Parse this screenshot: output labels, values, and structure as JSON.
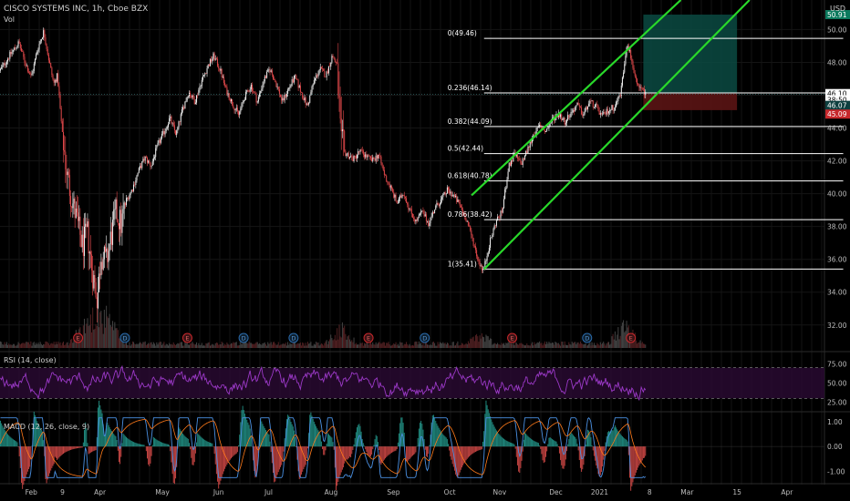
{
  "header": {
    "title": "CISCO SYSTEMS INC, 1h, Cboe BZX",
    "vol_label": "Vol",
    "currency": "USD"
  },
  "colors": {
    "up": "#f0f0f0",
    "down": "#e0484a",
    "channel": "#29d82a",
    "fib": "#ffffff",
    "rsi": "#9b39c7",
    "macd": "#4a90e2",
    "signal": "#ff7a1a",
    "profit_zone": "#0a4a42",
    "loss_zone": "#5a1414",
    "grid": "#1a1a1a"
  },
  "chart_data": [
    {
      "type": "line",
      "name": "price-pane",
      "subtype": "candlestick",
      "y_range": [
        30.6,
        51.8
      ],
      "y_ticks": [
        {
          "v": 50,
          "label": "50.00"
        },
        {
          "v": 48,
          "label": "48.00"
        },
        {
          "v": 46,
          "label": "46.00"
        },
        {
          "v": 44,
          "label": "44.00"
        },
        {
          "v": 42,
          "label": "42.00"
        },
        {
          "v": 40,
          "label": "40.00"
        },
        {
          "v": 38,
          "label": "38.00"
        },
        {
          "v": 36,
          "label": "36.00"
        },
        {
          "v": 34,
          "label": "34.00"
        },
        {
          "v": 32,
          "label": "32.00"
        }
      ],
      "x_ticks": [
        {
          "t": 0.5,
          "label": "Feb"
        },
        {
          "t": 1.0,
          "label": "9"
        },
        {
          "t": 1.6,
          "label": "Apr"
        },
        {
          "t": 2.6,
          "label": "May"
        },
        {
          "t": 3.5,
          "label": "Jun"
        },
        {
          "t": 4.3,
          "label": "Jul"
        },
        {
          "t": 5.3,
          "label": "Aug"
        },
        {
          "t": 6.3,
          "label": "Sep"
        },
        {
          "t": 7.2,
          "label": "Oct"
        },
        {
          "t": 8.0,
          "label": "Nov"
        },
        {
          "t": 8.9,
          "label": "Dec"
        },
        {
          "t": 9.6,
          "label": "2021"
        },
        {
          "t": 10.4,
          "label": "8"
        },
        {
          "t": 11.0,
          "label": "Mar"
        },
        {
          "t": 11.8,
          "label": "15"
        },
        {
          "t": 12.6,
          "label": "Apr"
        }
      ],
      "t_range": [
        0,
        13.2
      ],
      "price_path": [
        [
          0.0,
          47.5
        ],
        [
          0.15,
          48.4
        ],
        [
          0.3,
          49.2
        ],
        [
          0.4,
          48.0
        ],
        [
          0.5,
          47.1
        ],
        [
          0.6,
          48.8
        ],
        [
          0.7,
          49.9
        ],
        [
          0.78,
          48.2
        ],
        [
          0.86,
          46.7
        ],
        [
          0.92,
          47.2
        ],
        [
          1.0,
          43.5
        ],
        [
          1.08,
          41.0
        ],
        [
          1.16,
          39.5
        ],
        [
          1.24,
          38.2
        ],
        [
          1.32,
          36.8
        ],
        [
          1.4,
          37.6
        ],
        [
          1.48,
          35.2
        ],
        [
          1.56,
          33.6
        ],
        [
          1.62,
          36.4
        ],
        [
          1.7,
          35.8
        ],
        [
          1.78,
          37.4
        ],
        [
          1.86,
          38.9
        ],
        [
          1.94,
          38.1
        ],
        [
          2.02,
          39.6
        ],
        [
          2.12,
          40.3
        ],
        [
          2.22,
          41.4
        ],
        [
          2.32,
          42.2
        ],
        [
          2.42,
          41.7
        ],
        [
          2.52,
          42.9
        ],
        [
          2.62,
          43.7
        ],
        [
          2.72,
          44.6
        ],
        [
          2.82,
          43.6
        ],
        [
          2.92,
          45.1
        ],
        [
          3.02,
          46.2
        ],
        [
          3.12,
          45.6
        ],
        [
          3.22,
          46.8
        ],
        [
          3.32,
          47.7
        ],
        [
          3.42,
          48.4
        ],
        [
          3.52,
          47.6
        ],
        [
          3.62,
          46.3
        ],
        [
          3.72,
          45.5
        ],
        [
          3.82,
          44.8
        ],
        [
          3.92,
          45.9
        ],
        [
          4.02,
          46.6
        ],
        [
          4.12,
          45.6
        ],
        [
          4.22,
          46.9
        ],
        [
          4.32,
          47.6
        ],
        [
          4.42,
          46.7
        ],
        [
          4.52,
          45.6
        ],
        [
          4.62,
          46.4
        ],
        [
          4.72,
          47.1
        ],
        [
          4.82,
          46.2
        ],
        [
          4.92,
          45.3
        ],
        [
          5.02,
          46.8
        ],
        [
          5.12,
          47.6
        ],
        [
          5.22,
          47.2
        ],
        [
          5.32,
          48.4
        ],
        [
          5.4,
          47.8
        ],
        [
          5.46,
          42.6
        ],
        [
          5.56,
          42.4
        ],
        [
          5.66,
          42.1
        ],
        [
          5.76,
          42.6
        ],
        [
          5.86,
          42.3
        ],
        [
          5.96,
          42.0
        ],
        [
          6.06,
          42.4
        ],
        [
          6.16,
          41.1
        ],
        [
          6.26,
          40.3
        ],
        [
          6.36,
          39.4
        ],
        [
          6.46,
          40.1
        ],
        [
          6.56,
          39.0
        ],
        [
          6.66,
          38.3
        ],
        [
          6.76,
          38.9
        ],
        [
          6.86,
          38.2
        ],
        [
          6.96,
          39.1
        ],
        [
          7.06,
          39.6
        ],
        [
          7.16,
          40.2
        ],
        [
          7.26,
          39.9
        ],
        [
          7.36,
          39.3
        ],
        [
          7.46,
          38.5
        ],
        [
          7.56,
          37.3
        ],
        [
          7.66,
          35.9
        ],
        [
          7.74,
          35.3
        ],
        [
          7.84,
          37.0
        ],
        [
          7.94,
          38.3
        ],
        [
          8.04,
          38.9
        ],
        [
          8.14,
          41.6
        ],
        [
          8.24,
          42.4
        ],
        [
          8.34,
          41.8
        ],
        [
          8.44,
          42.6
        ],
        [
          8.54,
          43.6
        ],
        [
          8.64,
          44.1
        ],
        [
          8.74,
          43.8
        ],
        [
          8.84,
          44.5
        ],
        [
          8.94,
          44.9
        ],
        [
          9.04,
          44.4
        ],
        [
          9.14,
          44.9
        ],
        [
          9.24,
          45.4
        ],
        [
          9.34,
          44.8
        ],
        [
          9.44,
          45.6
        ],
        [
          9.54,
          45.3
        ],
        [
          9.64,
          44.7
        ],
        [
          9.74,
          45.1
        ],
        [
          9.84,
          45.3
        ],
        [
          9.94,
          46.2
        ],
        [
          10.04,
          49.3
        ],
        [
          10.12,
          48.0
        ],
        [
          10.2,
          46.5
        ],
        [
          10.28,
          46.3
        ],
        [
          10.36,
          46.1
        ]
      ],
      "volume_peaks": [
        [
          1.4,
          0.7
        ],
        [
          1.55,
          1.0
        ],
        [
          1.7,
          0.8
        ],
        [
          5.46,
          0.5
        ],
        [
          7.7,
          0.35
        ],
        [
          10.0,
          0.55
        ]
      ],
      "fib_levels": [
        {
          "ratio": "0",
          "price": 49.46,
          "label": "0(49.46)"
        },
        {
          "ratio": "0.236",
          "price": 46.14,
          "label": "0.236(46.14)"
        },
        {
          "ratio": "0.382",
          "price": 44.09,
          "label": "0.382(44.09)"
        },
        {
          "ratio": "0.5",
          "price": 42.44,
          "label": "0.5(42.44)"
        },
        {
          "ratio": "0.618",
          "price": 40.78,
          "label": "0.618(40.78)"
        },
        {
          "ratio": "0.786",
          "price": 38.42,
          "label": "0.786(38.42)"
        },
        {
          "ratio": "1",
          "price": 35.41,
          "label": "1(35.41)"
        }
      ],
      "fib_t_range": [
        7.75,
        13.5
      ],
      "channel_lower": [
        [
          7.75,
          35.4
        ],
        [
          12.0,
          51.8
        ]
      ],
      "channel_upper": [
        [
          7.55,
          39.9
        ],
        [
          10.9,
          51.8
        ]
      ],
      "position": {
        "t_start": 10.3,
        "t_end": 11.8,
        "entry": 46.1,
        "target": 50.91,
        "stop": 45.09
      },
      "price_labels": [
        {
          "price": 50.91,
          "label": "50.91",
          "bg": "#0c7a5e",
          "fg": "#ffffff"
        },
        {
          "price": 46.1,
          "label": "46.10",
          "bg": "#ffffff",
          "fg": "#000000"
        },
        {
          "price": 45.72,
          "label": "38:50",
          "bg": "#ffffff",
          "fg": "#000000"
        },
        {
          "price": 45.38,
          "label": "46.07",
          "bg": "#0e3f3f",
          "fg": "#ffffff"
        },
        {
          "price": 44.85,
          "label": "45.09",
          "bg": "#c8282c",
          "fg": "#ffffff"
        }
      ],
      "earnings_markers": [
        {
          "t": 1.25,
          "kind": "E"
        },
        {
          "t": 2.0,
          "kind": "D"
        },
        {
          "t": 3.0,
          "kind": "E"
        },
        {
          "t": 3.9,
          "kind": "D"
        },
        {
          "t": 4.7,
          "kind": "D"
        },
        {
          "t": 5.9,
          "kind": "E"
        },
        {
          "t": 6.8,
          "kind": "D"
        },
        {
          "t": 8.2,
          "kind": "E"
        },
        {
          "t": 9.4,
          "kind": "D"
        },
        {
          "t": 10.1,
          "kind": "E"
        }
      ]
    },
    {
      "type": "line",
      "name": "rsi-pane",
      "title": "RSI (14, close)",
      "y_range": [
        15,
        85
      ],
      "y_ticks": [
        {
          "v": 75,
          "label": "75.00"
        },
        {
          "v": 50,
          "label": "50.00"
        },
        {
          "v": 25,
          "label": "25.00"
        }
      ],
      "bands": [
        70,
        30
      ]
    },
    {
      "type": "line",
      "name": "macd-pane",
      "title": "MACD (12, 26, close, 9)",
      "y_range": [
        -1.35,
        1.25
      ],
      "y_ticks": [
        {
          "v": 1,
          "label": "1.00"
        },
        {
          "v": 0,
          "label": "0.00"
        },
        {
          "v": -1,
          "label": "-1.00"
        }
      ]
    }
  ]
}
